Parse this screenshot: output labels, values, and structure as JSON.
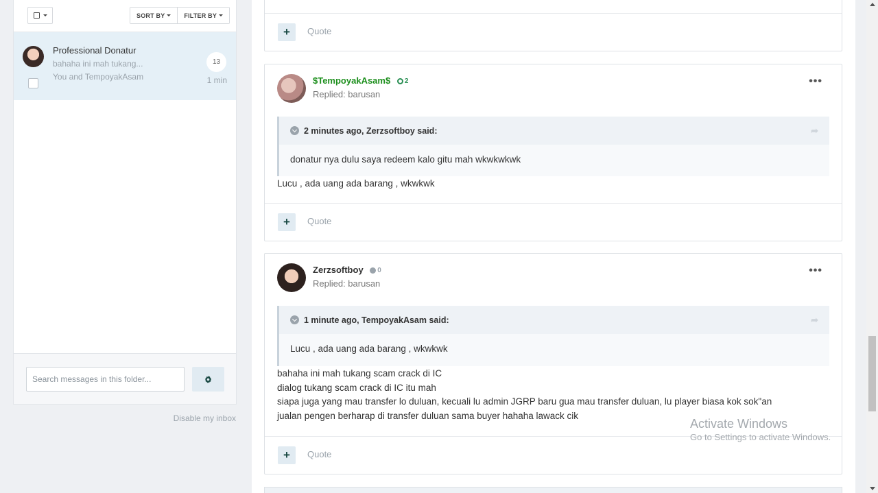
{
  "inbox": {
    "toolbar": {
      "sort_label": "SORT BY",
      "filter_label": "FILTER BY"
    },
    "conversation": {
      "title": "Professional Donatur",
      "snippet": "bahaha ini mah tukang...",
      "participants": "You and TempoyakAsam",
      "count": "13",
      "time": "1 min"
    },
    "search": {
      "placeholder": "Search messages in this folder..."
    },
    "disable_link": "Disable my inbox"
  },
  "posts": [
    {
      "action_label": "Quote"
    },
    {
      "author": "$TempoyakAsam$",
      "reputation": "2",
      "meta": "Replied: barusan",
      "quote_header": "2 minutes ago, Zerzsoftboy said:",
      "quote_text": "donatur nya dulu saya redeem kalo gitu mah wkwkwkwk",
      "body": [
        "Lucu , ada uang ada barang , wkwkwk"
      ],
      "action_label": "Quote"
    },
    {
      "author": "Zerzsoftboy",
      "reputation": "0",
      "meta": "Replied: barusan",
      "quote_header": "1 minute ago, TempoyakAsam said:",
      "quote_text": "Lucu , ada uang ada barang , wkwkwk",
      "body": [
        "bahaha ini mah tukang scam crack di IC",
        "dialog tukang scam crack di IC itu mah",
        "siapa juga yang mau transfer lo duluan, kecuali lu admin JGRP baru gua mau transfer duluan, lu player biasa kok sok\"an",
        "jualan pengen berharap di transfer duluan sama buyer hahaha lawack cik"
      ],
      "action_label": "Quote"
    }
  ],
  "watermark": {
    "line1": "Activate Windows",
    "line2": "Go to Settings to activate Windows."
  }
}
